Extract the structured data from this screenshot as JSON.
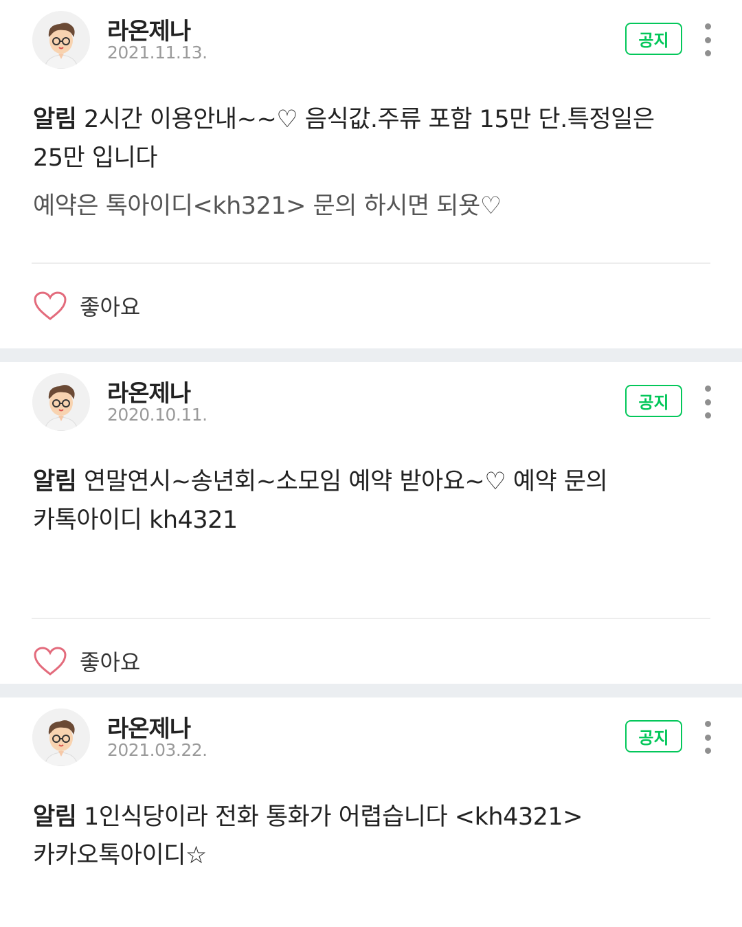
{
  "posts": [
    {
      "author": "라온제나",
      "date": "2021.11.13.",
      "badge": "공지",
      "tag": "알림",
      "text": " 2시간 이용안내~~♡ 음식값.주류 포함 15만 단.특정일은 25만 입니다",
      "subtext": "예약은 톡아이디<kh321> 문의 하시면 되욧♡",
      "like_label": "좋아요"
    },
    {
      "author": "라온제나",
      "date": "2020.10.11.",
      "badge": "공지",
      "tag": "알림",
      "text": " 연말연시~송년회~소모임 예약 받아요~♡ 예약 문의 카톡아이디 kh4321",
      "like_label": "좋아요"
    },
    {
      "author": "라온제나",
      "date": "2021.03.22.",
      "badge": "공지",
      "tag": "알림",
      "text": " 1인식당이라 전화 통화가 어렵습니다 <kh4321> 카카오톡아이디☆"
    }
  ],
  "icons": {
    "avatar": "avatar-icon",
    "more": "more-vertical-icon",
    "heart": "heart-outline-icon"
  },
  "colors": {
    "accent": "#03c75a",
    "heart": "#e36b7c",
    "separator": "#ebeef1"
  }
}
